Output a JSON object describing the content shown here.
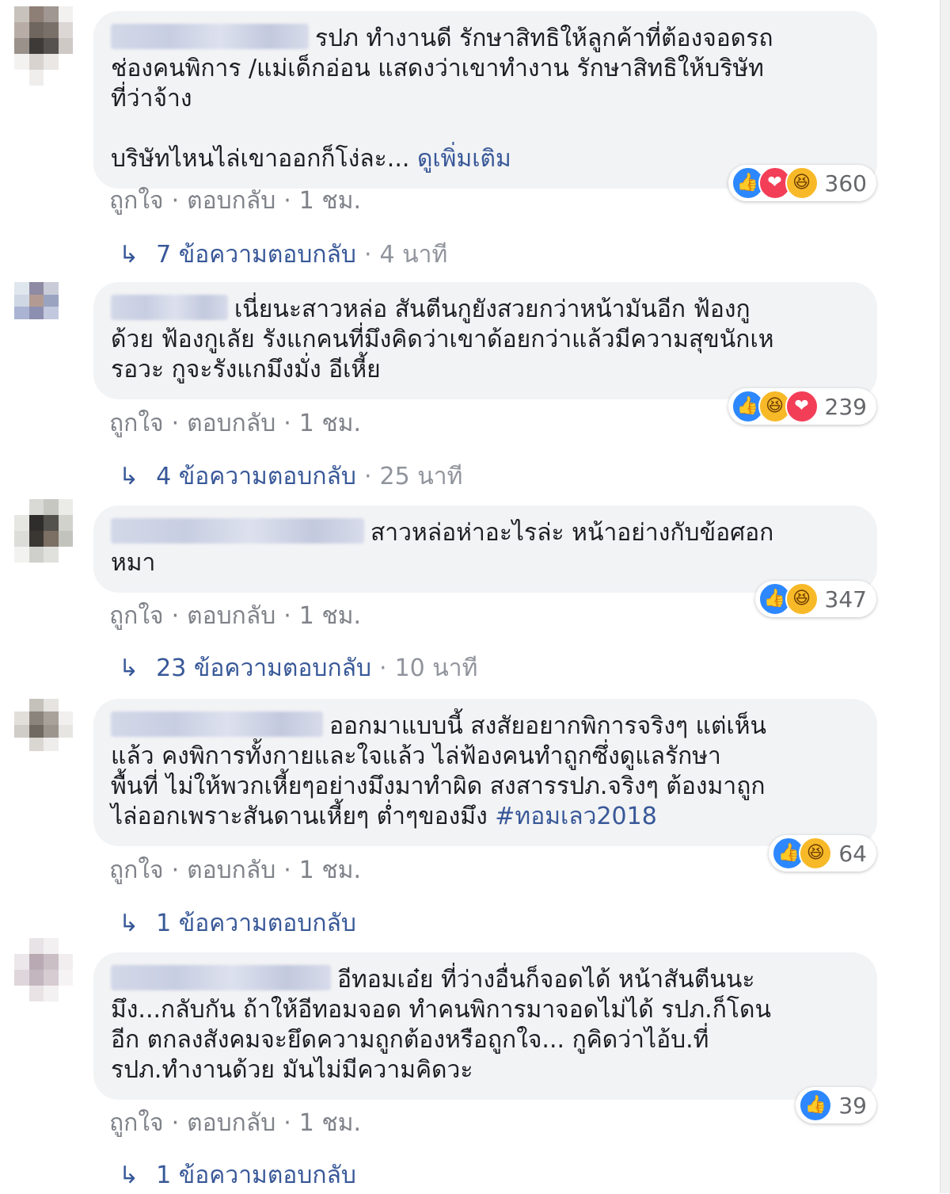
{
  "actions": {
    "like": "ถูกใจ",
    "reply": "ตอบกลับ",
    "separator": "·"
  },
  "comments": [
    {
      "text": "รปภ ทำงานดี รักษาสิทธิให้ลูกค้าที่ต้องจอดรถ\nช่องคนพิการ /แม่เด็กอ่อน แสดงว่าเขาทำงาน รักษาสิทธิให้บริษัท\nที่ว่าจ้าง\n\nบริษัทไหนไล่เขาออกก็โง่ละ...",
      "see_more": "ดูเพิ่มเติม",
      "reactions": [
        "like-icon",
        "love-icon",
        "haha-icon"
      ],
      "reaction_count": "360",
      "time": "1 ชม.",
      "replies_label": "7 ข้อความตอบกลับ",
      "replies_time": "4 นาที"
    },
    {
      "text": "เนี่ยนะสาวหล่อ สันตีนกูยังสวยกว่าหน้ามันอีก ฟ้องกู\nด้วย ฟ้องกูเลัย รังแกคนที่มึงคิดว่าเขาด้อยกว่าแล้วมีความสุขนักเห\nรอวะ กูจะรังแกมึงมั่ง อีเหี้ย",
      "reactions": [
        "like-icon",
        "haha-icon",
        "love-icon"
      ],
      "reaction_count": "239",
      "time": "1 ชม.",
      "replies_label": "4 ข้อความตอบกลับ",
      "replies_time": "25 นาที"
    },
    {
      "text": "สาวหล่อห่าอะไรล่ะ หน้าอย่างกับข้อศอก\nหมา",
      "reactions": [
        "like-icon",
        "haha-icon"
      ],
      "reaction_count": "347",
      "time": "1 ชม.",
      "replies_label": "23 ข้อความตอบกลับ",
      "replies_time": "10 นาที"
    },
    {
      "text": "ออกมาแบบนี้ สงสัยอยากพิการจริงๆ แต่เห็น\nแล้ว คงพิการทั้งกายและใจแล้ว ไล่ฟ้องคนทำถูกซึ่งดูแลรักษา\nพื้นที่ ไม่ให้พวกเหี้ยๆอย่างมึงมาทำผิด สงสารรปภ.จริงๆ ต้องมาถูก\nไล่ออกเพราะสันดานเหี้ยๆ ต่ำๆของมึง",
      "hashtag": "#ทอมเลว2018",
      "reactions": [
        "like-icon",
        "haha-icon"
      ],
      "reaction_count": "64",
      "time": "1 ชม.",
      "replies_label": "1 ข้อความตอบกลับ",
      "replies_time": ""
    },
    {
      "text": "อีทอมเอ๋ย ที่ว่างอื่นก็จอดได้ หน้าสันตีนนะ\nมึง...กลับกัน ถ้าให้อีทอมจอด ทำคนพิการมาจอดไม่ได้ รปภ.ก็โดน\nอีก ตกลงสังคมจะยึดความถูกต้องหรือถูกใจ... กูคิดว่าไอ้บ.ที่\nรปภ.ทำงานด้วย มันไม่มีความคิดวะ",
      "reactions": [
        "like-icon"
      ],
      "reaction_count": "39",
      "time": "1 ชม.",
      "replies_label": "1 ข้อความตอบกลับ",
      "replies_time": ""
    }
  ]
}
